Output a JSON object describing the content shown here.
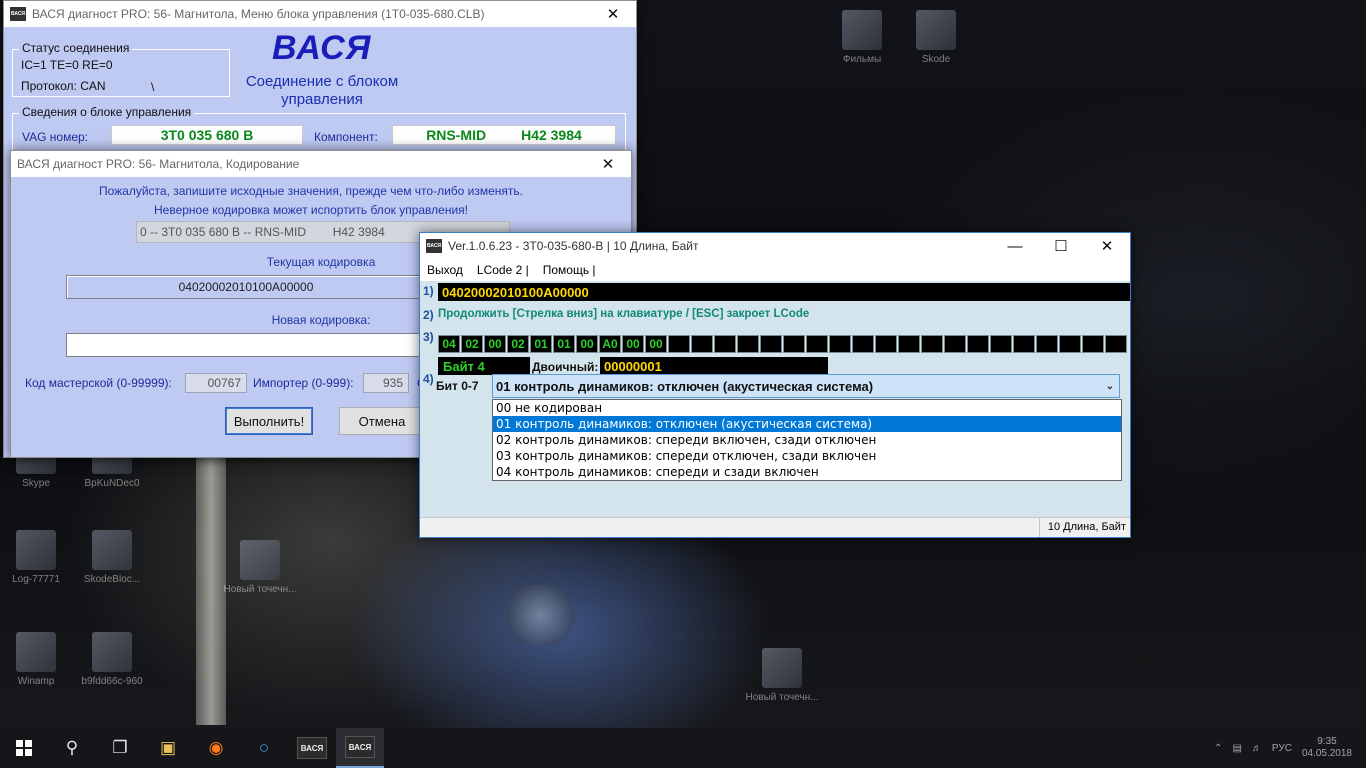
{
  "desktop": {
    "icons": [
      {
        "label": "Фильмы"
      },
      {
        "label": "Skode"
      },
      {
        "label": "Skype"
      },
      {
        "label": "BpKuNDec0"
      },
      {
        "label": "Log-77771"
      },
      {
        "label": "SkodeBloc..."
      },
      {
        "label": "Новый точечн..."
      },
      {
        "label": "Winamp"
      },
      {
        "label": "b9fdd66c-960"
      },
      {
        "label": "Новый точечн..."
      }
    ]
  },
  "taskbar": {
    "start_icon": "windows-logo-icon",
    "apps": [
      "ВАСЯ",
      "ВАСЯ"
    ],
    "tray_lang": "РУС",
    "clock_time": "9:35",
    "clock_date": "04.05.2018"
  },
  "main_window": {
    "title": "ВАСЯ диагност PRO: 56- Магнитола,  Меню блока управления (1T0-035-680.CLB)",
    "status_group_title": "Статус соединения",
    "status_line1": "IC=1  TE=0   RE=0",
    "status_line2": "Протокол: CAN",
    "status_spinner": "\\",
    "logo": "ВАСЯ",
    "logo_subtitle": "Соединение с блоком управления",
    "info_group_title": "Сведения о блоке управления",
    "vag_label": "VAG номер:",
    "vag_value": "3T0 035 680 B",
    "component_label": "Компонент:",
    "component_value": "RNS-MID         H42 3984"
  },
  "coding_dialog": {
    "title": "ВАСЯ диагност PRO: 56- Магнитола,  Кодирование",
    "warning1": "Пожалуйста, запишите исходные значения, прежде чем что-либо изменять.",
    "warning2": "Неверное кодировка может испортить блок управления!",
    "module_id": "0 -- 3T0 035 680 B -- RNS-MID        H42 3984",
    "current_label": "Текущая кодировка",
    "current_value": "04020002010100A00000",
    "new_label": "Новая кодировка:",
    "new_value": "",
    "workshop_label": "Код мастерской (0-99999):",
    "workshop_value": "00767",
    "importer_label": "Импортер (0-999):",
    "importer_value": "935",
    "equipment_label_partial": "О",
    "execute_button": "Выполнить!",
    "cancel_button": "Отмена"
  },
  "lcode_window": {
    "title": "Ver.1.0.6.23 -   3T0-035-680-B | 10 Длина, Байт",
    "menu": [
      "Выход",
      "LCode 2 |",
      "Помощь |"
    ],
    "step1": "1)",
    "coding_string": "04020002010100A00000",
    "step2": "2)",
    "hint": "Продолжить [Стрелка вниз] на клавиатуре / [ESC] закроет LCode",
    "step3": "3)",
    "bytes": [
      "04",
      "02",
      "00",
      "02",
      "01",
      "01",
      "00",
      "A0",
      "00",
      "00",
      "",
      "",
      "",
      "",
      "",
      "",
      "",
      "",
      "",
      "",
      "",
      "",
      "",
      "",
      "",
      "",
      "",
      "",
      "",
      ""
    ],
    "byte_label": "Байт 4",
    "binary_label": "Двоичный:",
    "binary_value": "00000001",
    "step4": "4)",
    "bit_label": "Бит 0-7",
    "selected_option": "01 контроль динамиков: отключен (акустическая система)",
    "options": [
      "00 не кодирован",
      "01 контроль динамиков: отключен (акустическая система)",
      "02 контроль динамиков: спереди включен, сзади отключен",
      "03 контроль динамиков: спереди отключен, сзади включен",
      "04 контроль динамиков: спереди и сзади включен"
    ],
    "selected_index": 1,
    "status_text": "10 Длина, Байт"
  }
}
